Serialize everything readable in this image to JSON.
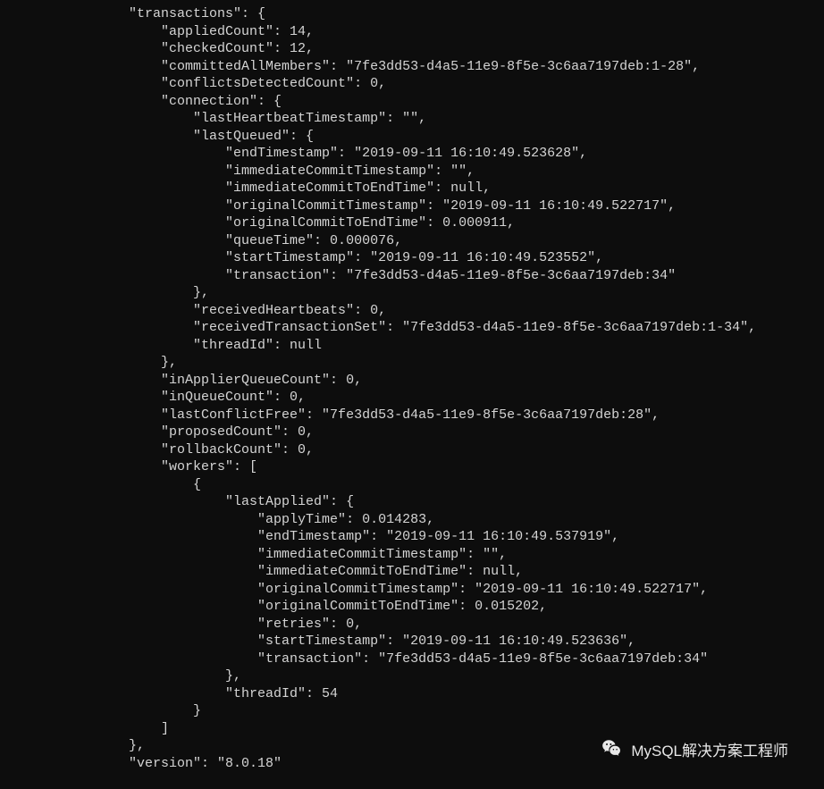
{
  "indentUnit": "    ",
  "baseIndent": 4,
  "json": {
    "transactions": {
      "appliedCount": 14,
      "checkedCount": 12,
      "committedAllMembers": "7fe3dd53-d4a5-11e9-8f5e-3c6aa7197deb:1-28",
      "conflictsDetectedCount": 0,
      "connection": {
        "lastHeartbeatTimestamp": "",
        "lastQueued": {
          "endTimestamp": "2019-09-11 16:10:49.523628",
          "immediateCommitTimestamp": "",
          "immediateCommitToEndTime": null,
          "originalCommitTimestamp": "2019-09-11 16:10:49.522717",
          "originalCommitToEndTime": 0.000911,
          "queueTime": 7.6e-05,
          "startTimestamp": "2019-09-11 16:10:49.523552",
          "transaction": "7fe3dd53-d4a5-11e9-8f5e-3c6aa7197deb:34"
        },
        "receivedHeartbeats": 0,
        "receivedTransactionSet": "7fe3dd53-d4a5-11e9-8f5e-3c6aa7197deb:1-34",
        "threadId": null
      },
      "inApplierQueueCount": 0,
      "inQueueCount": 0,
      "lastConflictFree": "7fe3dd53-d4a5-11e9-8f5e-3c6aa7197deb:28",
      "proposedCount": 0,
      "rollbackCount": 0,
      "workers": [
        {
          "lastApplied": {
            "applyTime": 0.014283,
            "endTimestamp": "2019-09-11 16:10:49.537919",
            "immediateCommitTimestamp": "",
            "immediateCommitToEndTime": null,
            "originalCommitTimestamp": "2019-09-11 16:10:49.522717",
            "originalCommitToEndTime": 0.015202,
            "retries": 0,
            "startTimestamp": "2019-09-11 16:10:49.523636",
            "transaction": "7fe3dd53-d4a5-11e9-8f5e-3c6aa7197deb:34"
          },
          "threadId": 54
        }
      ]
    },
    "version": "8.0.18"
  },
  "watermark": {
    "label": "MySQL解决方案工程师"
  }
}
